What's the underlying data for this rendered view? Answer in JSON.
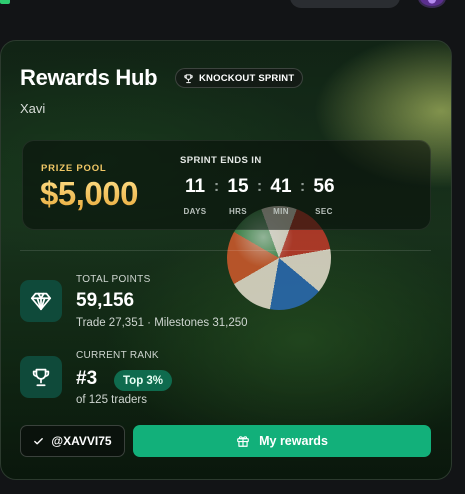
{
  "colors": {
    "accent": "#12b07a",
    "prize": "#f2c14e",
    "icon_bg": "#0f4a3a"
  },
  "card": {
    "title": "Rewards Hub",
    "badge": {
      "icon": "trophy-icon",
      "label": "KNOCKOUT SPRINT"
    },
    "username": "Xavi"
  },
  "prize": {
    "label": "PRIZE POOL",
    "amount": "$5,000",
    "sprint_label": "SPRINT ENDS IN",
    "countdown": [
      {
        "value": "11",
        "unit": "DAYS"
      },
      {
        "value": "15",
        "unit": "HRS"
      },
      {
        "value": "41",
        "unit": "MIN"
      },
      {
        "value": "56",
        "unit": "SEC"
      }
    ]
  },
  "stats": {
    "points": {
      "icon": "diamond-icon",
      "label": "TOTAL POINTS",
      "value": "59,156",
      "sub": "Trade 27,351 · Milestones 31,250"
    },
    "rank": {
      "icon": "trophy-icon",
      "label": "CURRENT RANK",
      "value": "#3",
      "badge": "Top 3%",
      "sub": "of 125 traders"
    }
  },
  "actions": {
    "handle": {
      "icon": "check-icon",
      "label": "@XAVVI75"
    },
    "rewards": {
      "icon": "gift-icon",
      "label": "My rewards"
    }
  }
}
